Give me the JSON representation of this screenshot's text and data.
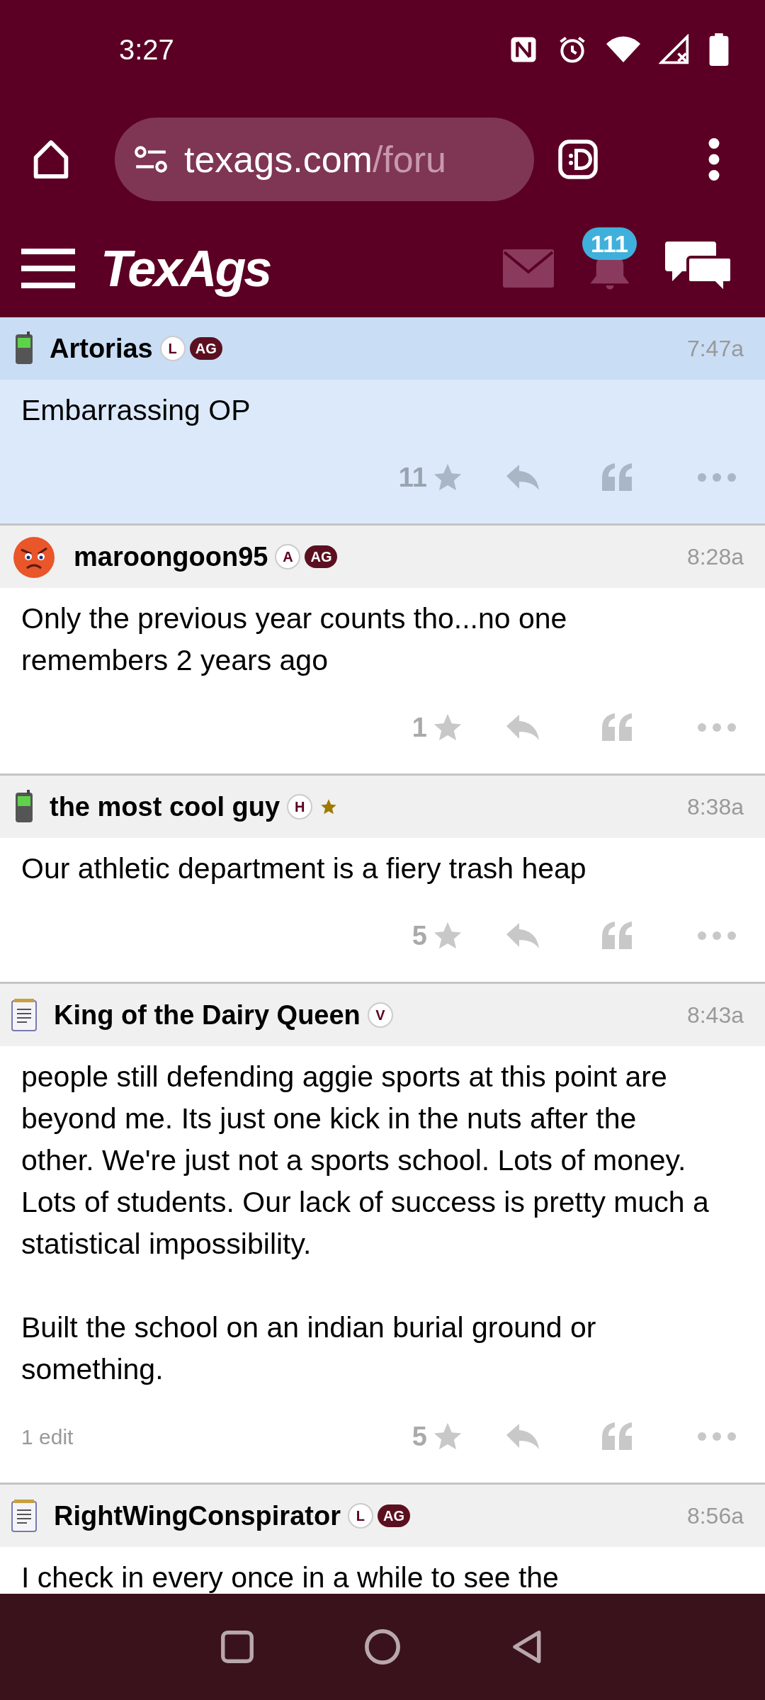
{
  "status_bar": {
    "time": "3:27"
  },
  "browser": {
    "url_host": "texags.com",
    "url_path": "/foru"
  },
  "site_header": {
    "logo": "TexAgs",
    "notification_count": "111"
  },
  "posts": [
    {
      "user": "Artorias",
      "kind": "phone",
      "highlighted": true,
      "badges": [
        {
          "kind": "circle",
          "text": "L"
        },
        {
          "kind": "pill",
          "text": "AG"
        }
      ],
      "time": "7:47a",
      "body": [
        "Embarrassing OP"
      ],
      "stars_count": "11"
    },
    {
      "user": "maroongoon95",
      "kind": "face",
      "highlighted": false,
      "badges": [
        {
          "kind": "circle",
          "text": "A"
        },
        {
          "kind": "pill",
          "text": "AG"
        }
      ],
      "time": "8:28a",
      "body": [
        "Only the previous year counts tho...no one remembers 2 years ago"
      ],
      "stars_count": "1"
    },
    {
      "user": "the most cool guy",
      "kind": "phone",
      "highlighted": false,
      "badges": [
        {
          "kind": "circle",
          "text": "H"
        },
        {
          "kind": "star"
        }
      ],
      "time": "8:38a",
      "body": [
        "Our athletic department is a fiery trash heap"
      ],
      "stars_count": "5"
    },
    {
      "user": "King of the Dairy Queen",
      "kind": "notepad",
      "highlighted": false,
      "badges": [
        {
          "kind": "circle",
          "text": "V"
        }
      ],
      "time": "8:43a",
      "body": [
        "people still defending aggie sports at this point are beyond me. Its just one kick in the nuts after the other. We're just not a sports school. Lots of money. Lots of students. Our lack of success is pretty much a statistical impossibility.",
        "Built the school on an indian burial ground or something."
      ],
      "edits": "1 edit",
      "stars_count": "5"
    },
    {
      "user": "RightWingConspirator",
      "kind": "notepad",
      "highlighted": false,
      "badges": [
        {
          "kind": "circle",
          "text": "L"
        },
        {
          "kind": "pill",
          "text": "AG"
        }
      ],
      "time": "8:56a",
      "body": [
        "I check in every once in a while to see the"
      ]
    }
  ]
}
